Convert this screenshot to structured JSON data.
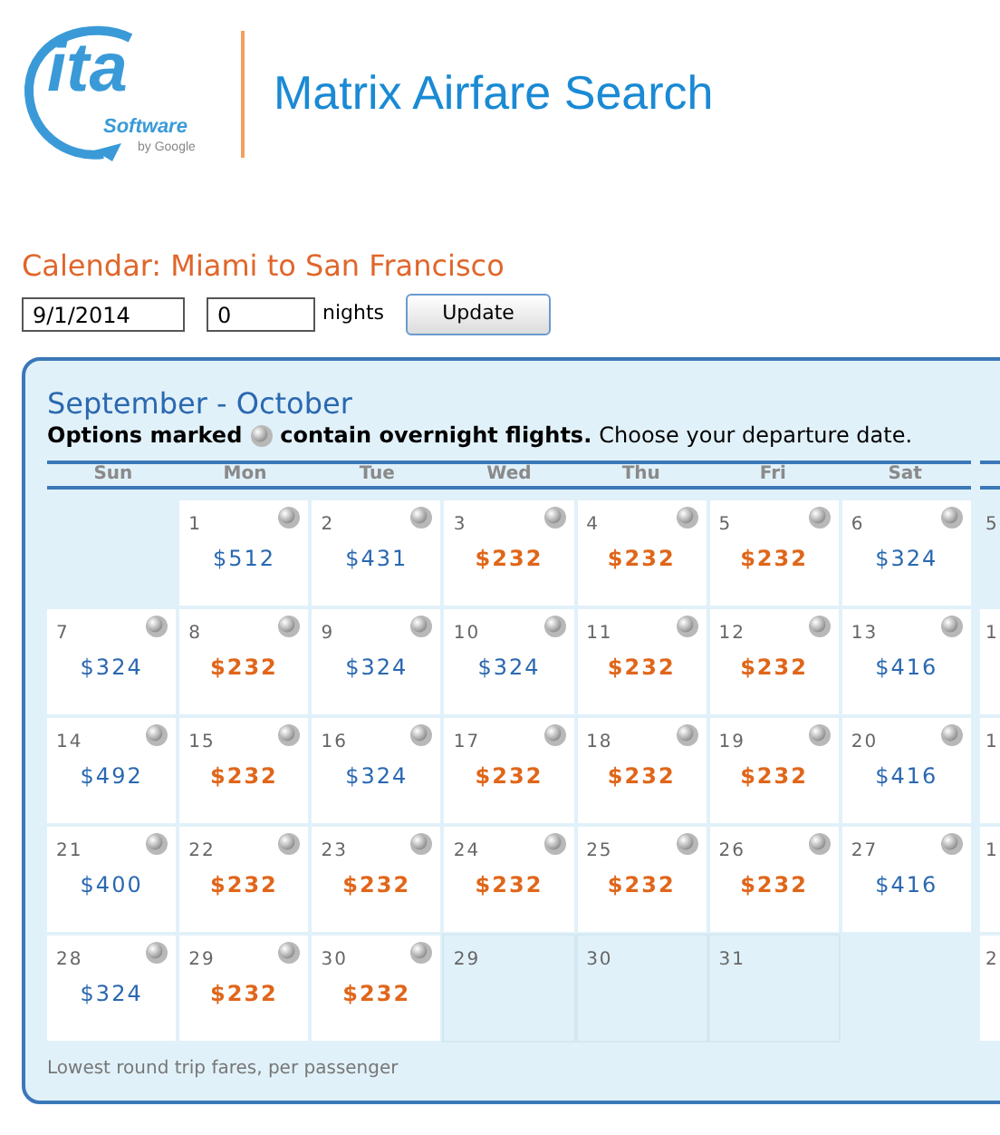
{
  "logo": {
    "mark": "ita",
    "word": "Software",
    "byline": "by Google"
  },
  "header": {
    "title": "Matrix Airfare Search"
  },
  "search": {
    "heading": "Calendar: Miami to San Francisco",
    "date": "9/1/2014",
    "nights": "0",
    "nights_label": "nights",
    "button": "Update"
  },
  "calendar": {
    "title": "September - October",
    "note_bold": "Options marked",
    "note_bold_after": "contain overnight flights.",
    "note_rest": "Choose your departure date.",
    "weekdays": [
      "Sun",
      "Mon",
      "Tue",
      "Wed",
      "Thu",
      "Fri",
      "Sat"
    ],
    "weeks": [
      [
        {
          "kind": "empty"
        },
        {
          "kind": "fare",
          "day": "1",
          "price": "$512",
          "cheapest": false,
          "overnight": true
        },
        {
          "kind": "fare",
          "day": "2",
          "price": "$431",
          "cheapest": false,
          "overnight": true
        },
        {
          "kind": "fare",
          "day": "3",
          "price": "$232",
          "cheapest": true,
          "overnight": true
        },
        {
          "kind": "fare",
          "day": "4",
          "price": "$232",
          "cheapest": true,
          "overnight": true
        },
        {
          "kind": "fare",
          "day": "5",
          "price": "$232",
          "cheapest": true,
          "overnight": true
        },
        {
          "kind": "fare",
          "day": "6",
          "price": "$324",
          "cheapest": false,
          "overnight": true
        }
      ],
      [
        {
          "kind": "fare",
          "day": "7",
          "price": "$324",
          "cheapest": false,
          "overnight": true
        },
        {
          "kind": "fare",
          "day": "8",
          "price": "$232",
          "cheapest": true,
          "overnight": true
        },
        {
          "kind": "fare",
          "day": "9",
          "price": "$324",
          "cheapest": false,
          "overnight": true
        },
        {
          "kind": "fare",
          "day": "10",
          "price": "$324",
          "cheapest": false,
          "overnight": true
        },
        {
          "kind": "fare",
          "day": "11",
          "price": "$232",
          "cheapest": true,
          "overnight": true
        },
        {
          "kind": "fare",
          "day": "12",
          "price": "$232",
          "cheapest": true,
          "overnight": true
        },
        {
          "kind": "fare",
          "day": "13",
          "price": "$416",
          "cheapest": false,
          "overnight": true
        }
      ],
      [
        {
          "kind": "fare",
          "day": "14",
          "price": "$492",
          "cheapest": false,
          "overnight": true
        },
        {
          "kind": "fare",
          "day": "15",
          "price": "$232",
          "cheapest": true,
          "overnight": true
        },
        {
          "kind": "fare",
          "day": "16",
          "price": "$324",
          "cheapest": false,
          "overnight": true
        },
        {
          "kind": "fare",
          "day": "17",
          "price": "$232",
          "cheapest": true,
          "overnight": true
        },
        {
          "kind": "fare",
          "day": "18",
          "price": "$232",
          "cheapest": true,
          "overnight": true
        },
        {
          "kind": "fare",
          "day": "19",
          "price": "$232",
          "cheapest": true,
          "overnight": true
        },
        {
          "kind": "fare",
          "day": "20",
          "price": "$416",
          "cheapest": false,
          "overnight": true
        }
      ],
      [
        {
          "kind": "fare",
          "day": "21",
          "price": "$400",
          "cheapest": false,
          "overnight": true
        },
        {
          "kind": "fare",
          "day": "22",
          "price": "$232",
          "cheapest": true,
          "overnight": true
        },
        {
          "kind": "fare",
          "day": "23",
          "price": "$232",
          "cheapest": true,
          "overnight": true
        },
        {
          "kind": "fare",
          "day": "24",
          "price": "$232",
          "cheapest": true,
          "overnight": true
        },
        {
          "kind": "fare",
          "day": "25",
          "price": "$232",
          "cheapest": true,
          "overnight": true
        },
        {
          "kind": "fare",
          "day": "26",
          "price": "$232",
          "cheapest": true,
          "overnight": true
        },
        {
          "kind": "fare",
          "day": "27",
          "price": "$416",
          "cheapest": false,
          "overnight": true
        }
      ],
      [
        {
          "kind": "fare",
          "day": "28",
          "price": "$324",
          "cheapest": false,
          "overnight": true
        },
        {
          "kind": "fare",
          "day": "29",
          "price": "$232",
          "cheapest": true,
          "overnight": true
        },
        {
          "kind": "fare",
          "day": "30",
          "price": "$232",
          "cheapest": true,
          "overnight": true
        },
        {
          "kind": "day",
          "day": "29"
        },
        {
          "kind": "day",
          "day": "30"
        },
        {
          "kind": "day",
          "day": "31"
        },
        {
          "kind": "empty"
        }
      ]
    ],
    "next_column_days": [
      "5",
      "1",
      "1",
      "1",
      "2"
    ],
    "footnote": "Lowest round trip fares, per passenger"
  }
}
